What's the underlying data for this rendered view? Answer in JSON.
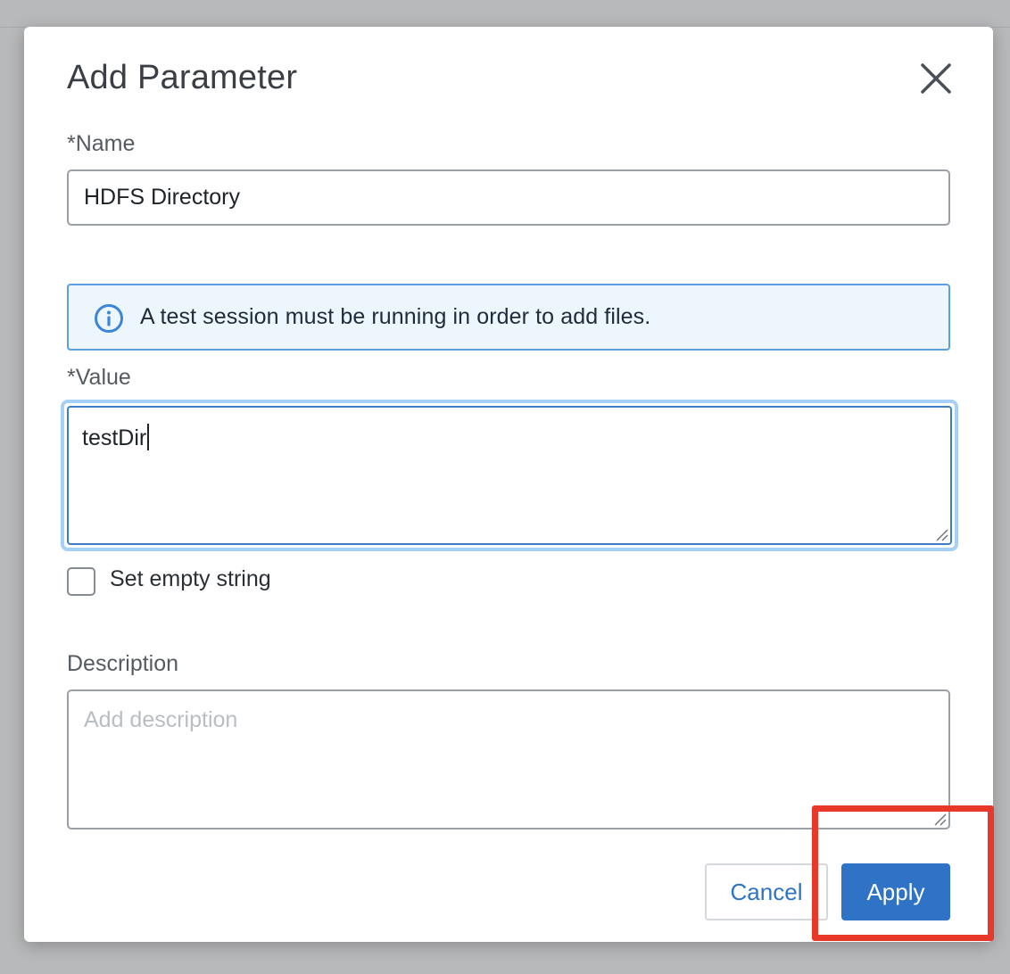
{
  "dialog": {
    "title": "Add Parameter",
    "close_icon": "close-icon"
  },
  "name": {
    "label": "*Name",
    "value": "HDFS Directory"
  },
  "info_banner": {
    "icon": "info-icon",
    "text": "A test session must be running in order to add files."
  },
  "value_field": {
    "label": "*Value",
    "value": "testDir"
  },
  "empty_string": {
    "label": "Set empty string",
    "checked": false
  },
  "description": {
    "label": "Description",
    "placeholder": "Add description",
    "value": ""
  },
  "buttons": {
    "cancel": "Cancel",
    "apply": "Apply"
  },
  "colors": {
    "primary": "#2f73c7",
    "info_bg": "#eef6fd",
    "info_border": "#5b9fe0",
    "annotation": "#e8382a",
    "backdrop": "#b8b9ba"
  }
}
